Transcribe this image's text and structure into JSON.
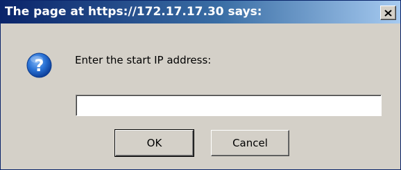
{
  "dialog": {
    "title": "The page at https://172.17.17.30 says:",
    "prompt": "Enter the start IP address:",
    "input_value": "",
    "ok_label": "OK",
    "cancel_label": "Cancel",
    "icon": "question-icon",
    "close_icon": "close-icon"
  },
  "colors": {
    "titlebar_start": "#0a246a",
    "titlebar_end": "#a6caf0",
    "face": "#d4d0c8",
    "icon_blue": "#1f6fd1"
  }
}
